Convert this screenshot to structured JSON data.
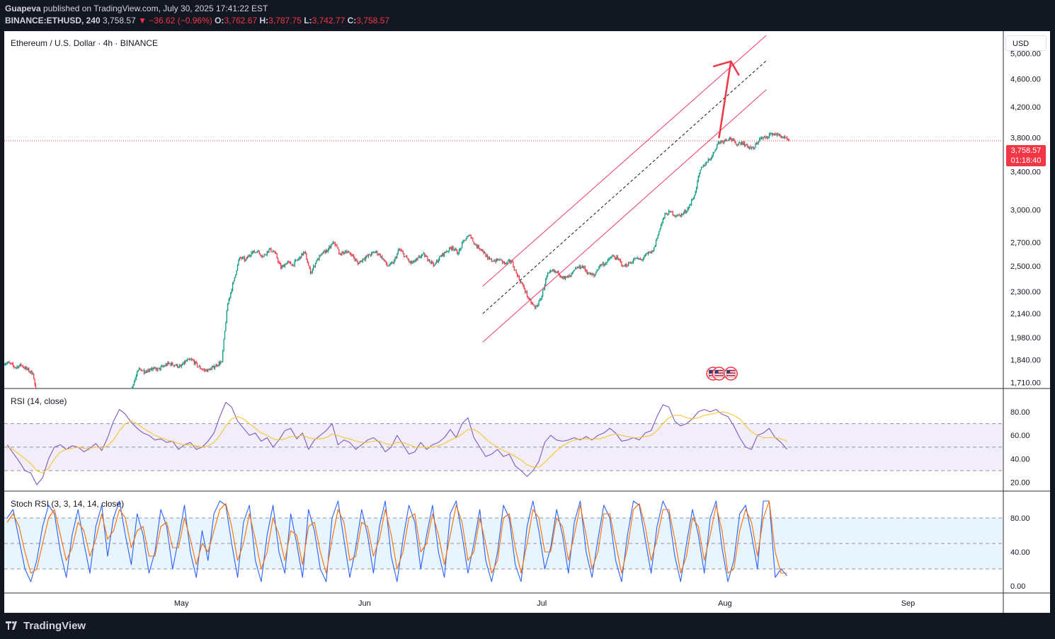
{
  "header": {
    "author": "Guapeva",
    "published": "published on TradingView.com, July 30, 2025 17:41:22 EST",
    "symbol": "BINANCE:ETHUSD, 240",
    "last": "3,758.57",
    "change": "−36.62 (−0.96%)",
    "o_label": "O:",
    "o": "3,762.67",
    "h_label": "H:",
    "h": "3,787.75",
    "l_label": "L:",
    "l": "3,742.77",
    "c_label": "C:",
    "c": "3,758.57"
  },
  "footer": {
    "brand": "TradingView"
  },
  "colors": {
    "up": "#089981",
    "down": "#f23645",
    "channel": "#f23a6a",
    "rsi": "#7e57c2",
    "rsi_ma": "#f7c531",
    "stoch_k": "#2962ff",
    "stoch_d": "#ff6d00"
  },
  "chart_data": [
    {
      "type": "candlestick",
      "title": "Ethereum / U.S. Dollar · 4h · BINANCE",
      "currency": "USD",
      "y_scale": "log",
      "ylim": [
        1700,
        5300
      ],
      "yticks": [
        "5,000.00",
        "4,600.00",
        "4,200.00",
        "3,800.00",
        "3,400.00",
        "3,000.00",
        "2,700.00",
        "2,500.00",
        "2,300.00",
        "2,140.00",
        "1,980.00",
        "1,840.00",
        "1,710.00"
      ],
      "ytick_values": [
        5000,
        4600,
        4200,
        3800,
        3400,
        3000,
        2700,
        2500,
        2300,
        2140,
        1980,
        1840,
        1710
      ],
      "xticks": [
        "May",
        "Jun",
        "Jul",
        "Aug",
        "Sep"
      ],
      "xtick_dates": [
        "2025-05-01",
        "2025-06-01",
        "2025-07-01",
        "2025-08-01",
        "2025-09-01"
      ],
      "x_range": [
        "2025-04-01",
        "2025-09-17"
      ],
      "last_price": "3,758.57",
      "countdown": "01:18:40",
      "daily_closes": {
        "dates_start": "2025-04-01",
        "values": [
          1822,
          1795,
          1810,
          1785,
          1760,
          1570,
          1475,
          1520,
          1545,
          1500,
          1580,
          1620,
          1600,
          1580,
          1600,
          1610,
          1590,
          1600,
          1595,
          1610,
          1620,
          1700,
          1790,
          1770,
          1790,
          1780,
          1800,
          1820,
          1810,
          1800,
          1835,
          1840,
          1800,
          1780,
          1780,
          1810,
          1830,
          2210,
          2380,
          2570,
          2550,
          2610,
          2620,
          2580,
          2640,
          2610,
          2480,
          2530,
          2510,
          2560,
          2620,
          2440,
          2540,
          2600,
          2640,
          2700,
          2600,
          2620,
          2590,
          2520,
          2560,
          2590,
          2620,
          2580,
          2500,
          2520,
          2640,
          2580,
          2520,
          2550,
          2600,
          2550,
          2510,
          2580,
          2620,
          2660,
          2600,
          2720,
          2760,
          2670,
          2640,
          2560,
          2540,
          2550,
          2520,
          2540,
          2420,
          2340,
          2240,
          2180,
          2240,
          2420,
          2460,
          2440,
          2400,
          2420,
          2480,
          2500,
          2440,
          2420,
          2510,
          2520,
          2580,
          2560,
          2500,
          2520,
          2560,
          2550,
          2600,
          2620,
          2800,
          2960,
          2980,
          2940,
          2960,
          3020,
          3150,
          3420,
          3500,
          3580,
          3740,
          3760,
          3800,
          3720,
          3740,
          3690,
          3660,
          3780,
          3800,
          3850,
          3840,
          3800,
          3759
        ]
      },
      "channel": {
        "upper": [
          [
            "2025-06-21",
            2340
          ],
          [
            "2025-08-08",
            5300
          ]
        ],
        "middle": [
          [
            "2025-06-21",
            2140
          ],
          [
            "2025-08-08",
            4880
          ]
        ],
        "lower": [
          [
            "2025-06-21",
            1950
          ],
          [
            "2025-08-08",
            4440
          ]
        ]
      },
      "projection_arrow": [
        [
          "2025-07-31",
          3800
        ],
        [
          "2025-08-02",
          4870
        ]
      ],
      "event_markers": [
        [
          "2025-07-30",
          1760
        ],
        [
          "2025-07-31",
          1760
        ],
        [
          "2025-08-02",
          1760
        ]
      ]
    },
    {
      "type": "line",
      "title": "RSI (14, close)",
      "ylim": [
        15,
        95
      ],
      "yticks": [
        "80.00",
        "60.00",
        "40.00",
        "20.00"
      ],
      "ytick_values": [
        80,
        60,
        40,
        20
      ],
      "bands": [
        30,
        50,
        70
      ],
      "series": [
        {
          "name": "RSI",
          "values": [
            52,
            45,
            38,
            30,
            28,
            18,
            24,
            40,
            50,
            52,
            48,
            51,
            50,
            46,
            49,
            53,
            47,
            58,
            72,
            82,
            78,
            71,
            66,
            62,
            60,
            56,
            57,
            54,
            55,
            48,
            52,
            54,
            48,
            50,
            55,
            62,
            76,
            88,
            84,
            72,
            66,
            60,
            62,
            55,
            58,
            50,
            56,
            64,
            66,
            57,
            62,
            48,
            56,
            60,
            64,
            70,
            52,
            56,
            54,
            48,
            52,
            56,
            58,
            54,
            46,
            50,
            60,
            52,
            44,
            46,
            54,
            48,
            52,
            54,
            58,
            65,
            58,
            70,
            75,
            58,
            50,
            42,
            44,
            48,
            42,
            44,
            34,
            30,
            25,
            30,
            38,
            54,
            60,
            56,
            55,
            56,
            58,
            56,
            59,
            56,
            60,
            62,
            66,
            62,
            55,
            56,
            58,
            56,
            62,
            64,
            76,
            86,
            84,
            72,
            68,
            70,
            74,
            80,
            82,
            80,
            82,
            78,
            76,
            68,
            58,
            50,
            48,
            60,
            62,
            66,
            58,
            54,
            48
          ]
        },
        {
          "name": "RSI-based MA",
          "values": [
            50,
            48,
            44,
            40,
            36,
            30,
            28,
            32,
            40,
            46,
            48,
            49,
            50,
            49,
            49,
            50,
            49,
            51,
            56,
            64,
            70,
            72,
            70,
            66,
            63,
            60,
            58,
            56,
            55,
            53,
            52,
            52,
            51,
            50,
            51,
            54,
            60,
            68,
            74,
            76,
            74,
            70,
            66,
            62,
            60,
            57,
            56,
            57,
            59,
            59,
            60,
            58,
            57,
            57,
            58,
            61,
            60,
            58,
            57,
            55,
            54,
            54,
            55,
            55,
            53,
            52,
            54,
            54,
            52,
            50,
            50,
            50,
            50,
            51,
            53,
            56,
            58,
            61,
            65,
            65,
            62,
            57,
            53,
            50,
            47,
            45,
            42,
            39,
            35,
            33,
            33,
            37,
            42,
            47,
            51,
            54,
            56,
            57,
            57,
            57,
            57,
            58,
            60,
            61,
            60,
            59,
            58,
            58,
            59,
            60,
            64,
            70,
            75,
            77,
            77,
            75,
            74,
            75,
            77,
            78,
            79,
            80,
            79,
            77,
            74,
            68,
            63,
            60,
            58,
            58,
            58,
            57,
            55
          ]
        }
      ]
    },
    {
      "type": "line",
      "title": "Stoch RSI (3, 3, 14, 14, close)",
      "ylim": [
        -5,
        105
      ],
      "yticks": [
        "80.00",
        "40.00",
        "0.00"
      ],
      "ytick_values": [
        80,
        40,
        0
      ],
      "bands": [
        20,
        50,
        80
      ],
      "series": [
        {
          "name": "K",
          "values": [
            80,
            90,
            55,
            20,
            5,
            30,
            70,
            95,
            85,
            40,
            10,
            60,
            90,
            50,
            15,
            70,
            95,
            35,
            80,
            100,
            60,
            25,
            85,
            60,
            15,
            40,
            90,
            70,
            20,
            55,
            95,
            40,
            10,
            65,
            30,
            85,
            100,
            95,
            50,
            10,
            75,
            95,
            30,
            5,
            60,
            95,
            40,
            15,
            85,
            50,
            10,
            90,
            65,
            20,
            5,
            80,
            100,
            55,
            10,
            45,
            90,
            60,
            15,
            70,
            100,
            35,
            5,
            55,
            95,
            75,
            20,
            60,
            95,
            40,
            10,
            85,
            100,
            60,
            15,
            50,
            90,
            30,
            5,
            40,
            95,
            80,
            25,
            5,
            70,
            100,
            65,
            20,
            45,
            90,
            60,
            15,
            75,
            100,
            40,
            10,
            55,
            95,
            80,
            30,
            5,
            60,
            100,
            95,
            55,
            15,
            70,
            100,
            85,
            35,
            5,
            50,
            90,
            60,
            15,
            80,
            100,
            45,
            5,
            30,
            85,
            95,
            60,
            20,
            100,
            100,
            10,
            20,
            12
          ]
        },
        {
          "name": "D",
          "values": [
            75,
            85,
            70,
            40,
            15,
            20,
            50,
            80,
            90,
            60,
            30,
            45,
            75,
            65,
            35,
            55,
            85,
            55,
            65,
            90,
            80,
            45,
            65,
            70,
            35,
            35,
            70,
            75,
            45,
            45,
            80,
            55,
            25,
            50,
            40,
            65,
            90,
            97,
            70,
            30,
            50,
            85,
            55,
            20,
            40,
            80,
            60,
            30,
            65,
            60,
            25,
            70,
            75,
            40,
            15,
            55,
            90,
            75,
            30,
            35,
            75,
            70,
            35,
            55,
            90,
            60,
            20,
            40,
            80,
            85,
            40,
            50,
            85,
            60,
            25,
            60,
            95,
            75,
            30,
            40,
            80,
            50,
            15,
            30,
            80,
            85,
            45,
            15,
            50,
            90,
            80,
            40,
            40,
            80,
            70,
            30,
            60,
            95,
            60,
            20,
            40,
            85,
            85,
            50,
            15,
            45,
            90,
            97,
            70,
            30,
            55,
            90,
            90,
            55,
            15,
            35,
            80,
            70,
            30,
            60,
            95,
            65,
            15,
            20,
            65,
            90,
            75,
            35,
            80,
            100,
            40,
            15,
            15
          ]
        }
      ]
    }
  ]
}
